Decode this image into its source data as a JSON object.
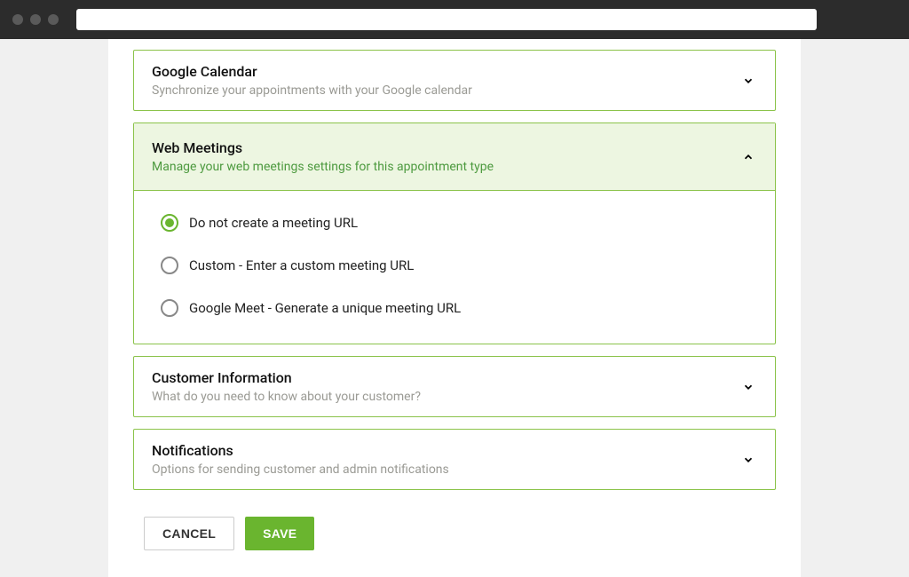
{
  "panels": {
    "google_calendar": {
      "title": "Google Calendar",
      "sub": "Synchronize your appointments with your Google calendar"
    },
    "web_meetings": {
      "title": "Web Meetings",
      "sub": "Manage your web meetings settings for this appointment type",
      "options": [
        {
          "label": "Do not create a meeting URL"
        },
        {
          "label": "Custom - Enter a custom meeting URL"
        },
        {
          "label": "Google Meet - Generate a unique meeting URL"
        }
      ]
    },
    "customer_info": {
      "title": "Customer Information",
      "sub": "What do you need to know about your customer?"
    },
    "notifications": {
      "title": "Notifications",
      "sub": "Options for sending customer and admin notifications"
    }
  },
  "buttons": {
    "cancel": "CANCEL",
    "save": "SAVE"
  }
}
